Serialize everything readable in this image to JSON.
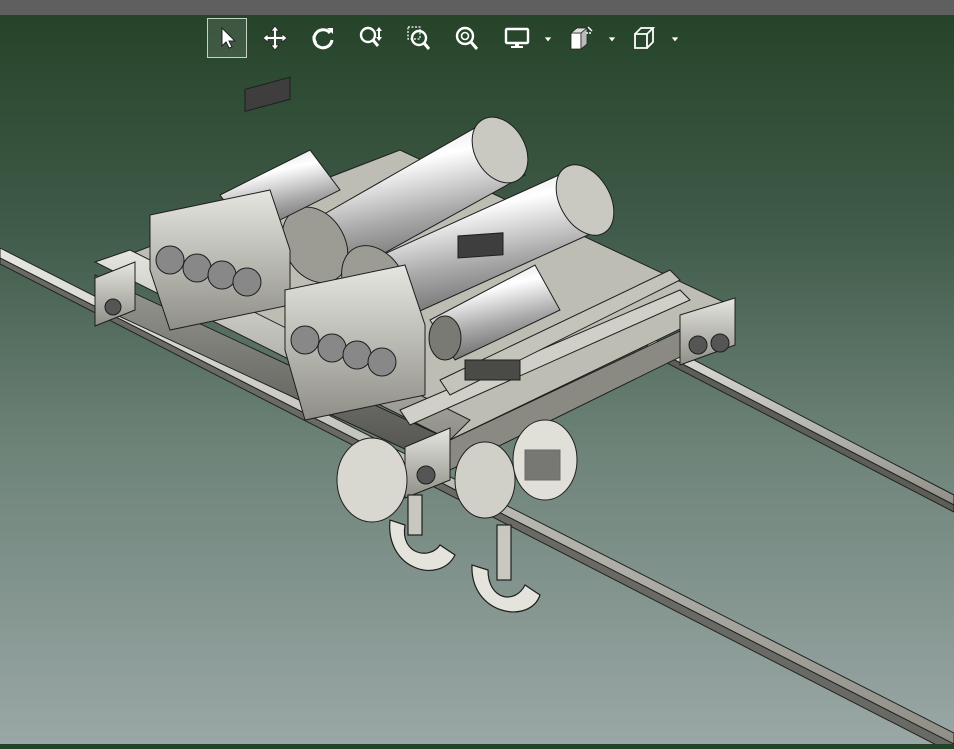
{
  "window": {
    "title_bar_color": "#5f5f5f"
  },
  "viewport": {
    "background_top": "#244227",
    "background_bottom": "#9aa7a6",
    "model": "crane-trolley-assembly"
  },
  "toolbar": {
    "tools": [
      {
        "id": "select",
        "icon": "select-arrow-icon",
        "active": true
      },
      {
        "id": "pan",
        "icon": "pan-move-icon",
        "active": false
      },
      {
        "id": "rotate",
        "icon": "rotate-icon",
        "active": false
      },
      {
        "id": "zoom-dynamic",
        "icon": "zoom-dynamic-icon",
        "active": false
      },
      {
        "id": "zoom-window",
        "icon": "zoom-window-icon",
        "active": false
      },
      {
        "id": "zoom-fit",
        "icon": "zoom-fit-icon",
        "active": false
      },
      {
        "id": "display-mode",
        "icon": "monitor-icon",
        "dropdown": true
      },
      {
        "id": "section",
        "icon": "section-view-icon",
        "dropdown": true
      },
      {
        "id": "view-orientation",
        "icon": "cube-view-icon",
        "dropdown": true
      }
    ]
  }
}
